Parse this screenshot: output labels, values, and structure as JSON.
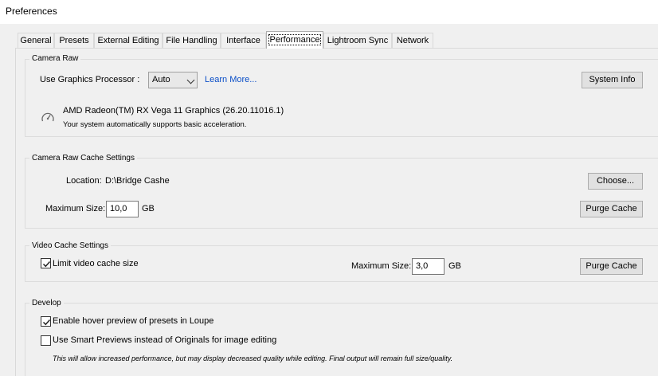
{
  "window": {
    "title": "Preferences"
  },
  "tabs": [
    {
      "label": "General"
    },
    {
      "label": "Presets"
    },
    {
      "label": "External Editing"
    },
    {
      "label": "File Handling"
    },
    {
      "label": "Interface"
    },
    {
      "label": "Performance",
      "active": true
    },
    {
      "label": "Lightroom Sync"
    },
    {
      "label": "Network"
    }
  ],
  "camera_raw": {
    "legend": "Camera Raw",
    "gpu_label": "Use Graphics Processor :",
    "gpu_value": "Auto",
    "learn_more": "Learn More...",
    "system_info_button": "System Info",
    "gpu_name": "AMD Radeon(TM) RX Vega 11 Graphics (26.20.11016.1)",
    "gpu_status": "Your system automatically supports basic acceleration."
  },
  "cache": {
    "legend": "Camera Raw Cache Settings",
    "location_label": "Location:",
    "location_value": "D:\\Bridge Cashe",
    "choose_button": "Choose...",
    "max_size_label": "Maximum Size:",
    "max_size_value": "10,0",
    "unit": "GB",
    "purge_button": "Purge Cache"
  },
  "video_cache": {
    "legend": "Video Cache Settings",
    "limit_label": "Limit video cache size",
    "limit_checked": true,
    "max_size_label": "Maximum Size:",
    "max_size_value": "3,0",
    "unit": "GB",
    "purge_button": "Purge Cache"
  },
  "develop": {
    "legend": "Develop",
    "hover_label": "Enable hover preview of presets in Loupe",
    "hover_checked": true,
    "smart_label": "Use Smart Previews instead of Originals for image editing",
    "smart_checked": false,
    "note": "This will allow increased performance, but may display decreased quality while editing. Final output will remain full size/quality."
  }
}
